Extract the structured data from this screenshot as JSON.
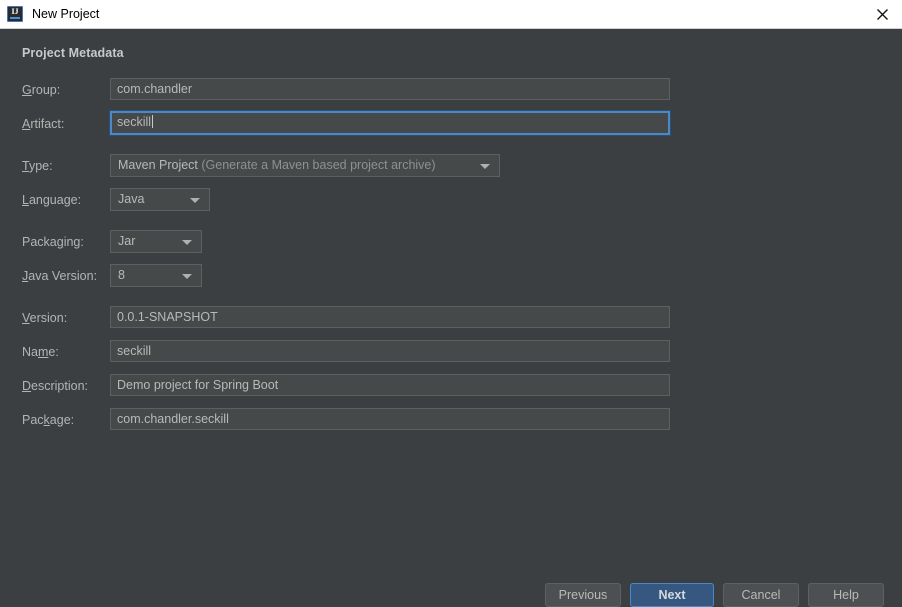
{
  "window": {
    "title": "New Project",
    "icon": "intellij-idea-logo",
    "close_icon": "close-icon",
    "logo_text": "IJ"
  },
  "section": {
    "heading": "Project Metadata"
  },
  "fields": {
    "group": {
      "label": "Group:",
      "mnemonic": "G",
      "value": "com.chandler"
    },
    "artifact": {
      "label": "Artifact:",
      "mnemonic": "A",
      "value": "seckill",
      "focused": true
    },
    "type": {
      "label": "Type:",
      "mnemonic": "T",
      "value": "Maven Project",
      "value_hint": "(Generate a Maven based project archive)"
    },
    "language": {
      "label": "Language:",
      "mnemonic": "L",
      "value": "Java"
    },
    "packaging": {
      "label": "Packaging:",
      "mnemonic": "g",
      "value": "Jar"
    },
    "java_version": {
      "label": "Java Version:",
      "mnemonic": "J",
      "value": "8"
    },
    "version": {
      "label": "Version:",
      "mnemonic": "V",
      "value": "0.0.1-SNAPSHOT"
    },
    "name": {
      "label": "Name:",
      "mnemonic": "m",
      "value": "seckill"
    },
    "description": {
      "label": "Description:",
      "mnemonic": "D",
      "value": "Demo project for Spring Boot"
    },
    "package": {
      "label": "Package:",
      "mnemonic": "k",
      "value": "com.chandler.seckill"
    }
  },
  "buttons": {
    "previous": "Previous",
    "next": "Next",
    "cancel": "Cancel",
    "help": "Help"
  },
  "colors": {
    "dialog_bg": "#3c3f41",
    "field_bg": "#45494a",
    "titlebar_bg": "#ffffff",
    "accent": "#4a88c7",
    "primary_button_bg": "#365880",
    "text": "#b9b9b9"
  }
}
